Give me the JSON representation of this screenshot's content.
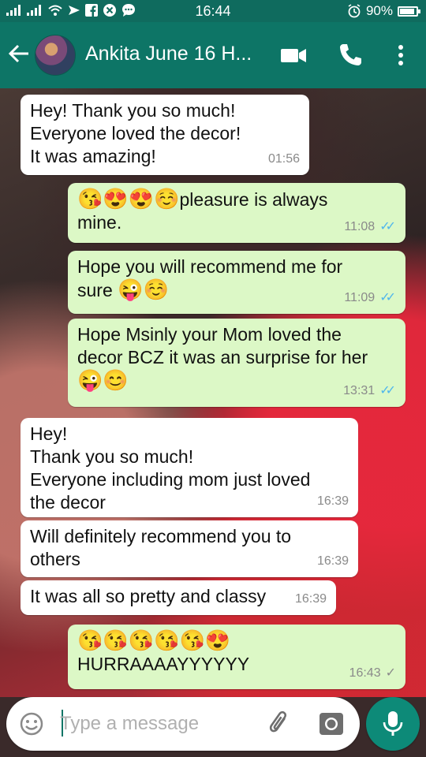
{
  "status_bar": {
    "time": "16:44",
    "battery": "90%",
    "battery_level": 0.9,
    "left_icons": [
      "signal-icon",
      "signal-icon",
      "wifi-icon",
      "send-icon",
      "facebook-icon",
      "close-circle-icon",
      "chat-bubble-icon"
    ],
    "right_icons": [
      "alarm-icon",
      "battery-icon"
    ]
  },
  "header": {
    "contact_name": "Ankita June 16 H...",
    "icons": [
      "back-arrow-icon",
      "avatar",
      "video-call-icon",
      "phone-call-icon",
      "more-options-icon"
    ]
  },
  "messages": [
    {
      "dir": "in",
      "text": "Hey! Thank you so much!\nEveryone loved the decor!\nIt was amazing!",
      "time": "01:56"
    },
    {
      "dir": "out",
      "emoji": "😘😍😍☺️",
      "text": "pleasure is always\nmine.",
      "time": "11:08",
      "status": "read"
    },
    {
      "dir": "out",
      "text": "Hope you will recommend me for\nsure ",
      "emoji_after": "😜☺️",
      "time": "11:09",
      "status": "read"
    },
    {
      "dir": "out",
      "text": "Hope Msinly your Mom loved the\ndecor BCZ it was an surprise for her\n",
      "emoji_after": "😜😊",
      "time": "13:31",
      "status": "read"
    },
    {
      "dir": "in",
      "text": "Hey!\nThank you so much!\nEveryone including mom just loved\nthe decor",
      "time": "16:39"
    },
    {
      "dir": "in",
      "text": "Will definitely recommend you to\nothers",
      "time": "16:39"
    },
    {
      "dir": "in",
      "text": "It was all so pretty and classy",
      "time": "16:39"
    },
    {
      "dir": "out",
      "emoji": "😘😘😘😘😘😍",
      "text": "\nHURRAAAAYYYYYY",
      "time": "16:43",
      "status": "sent"
    }
  ],
  "composer": {
    "placeholder": "Type a message",
    "icons": [
      "emoji-icon",
      "attach-icon",
      "camera-icon",
      "mic-icon"
    ]
  },
  "colors": {
    "header": "#0d7566",
    "status_bar": "#0f6b5e",
    "incoming_bubble": "#ffffff",
    "outgoing_bubble": "#dcf8c6",
    "read_tick": "#4fb6ec"
  }
}
